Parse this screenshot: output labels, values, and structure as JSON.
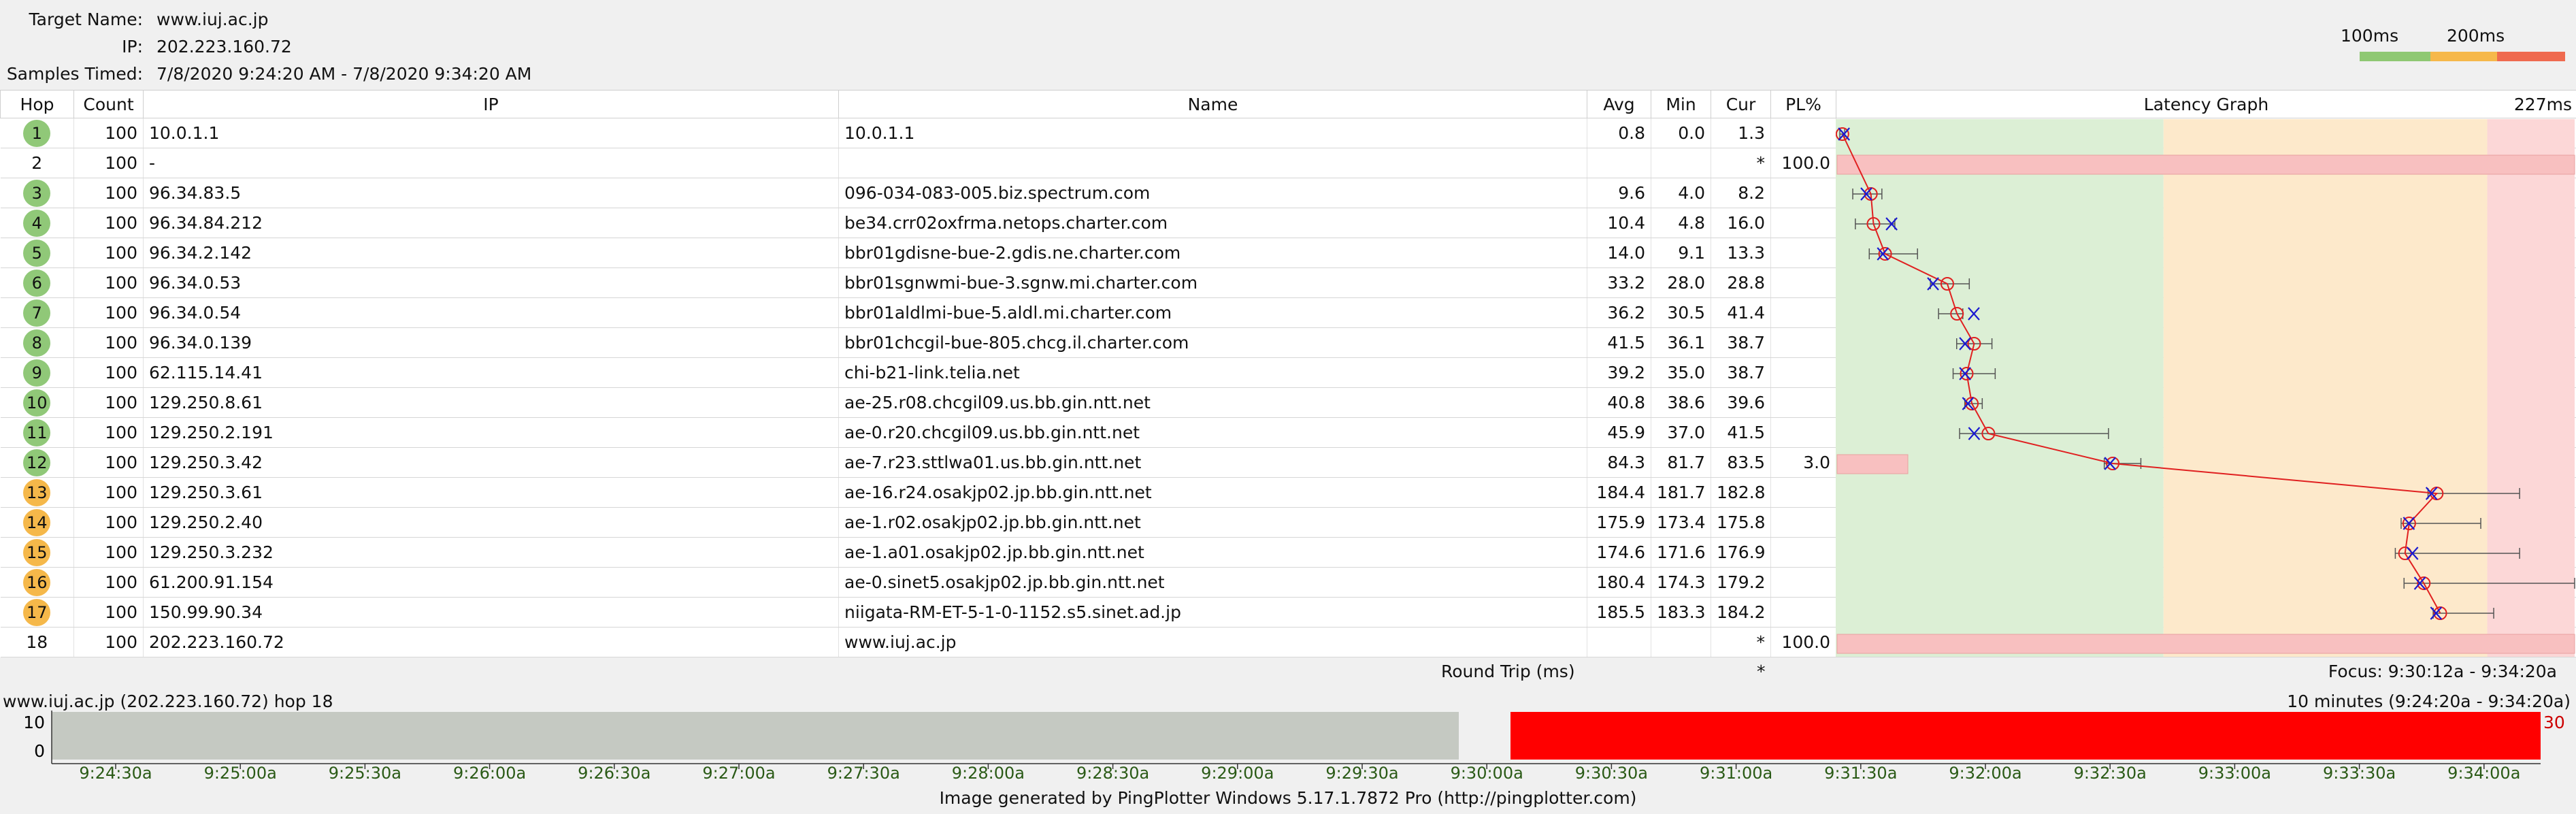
{
  "header": {
    "target_label": "Target Name:",
    "target_value": "www.iuj.ac.jp",
    "ip_label": "IP:",
    "ip_value": "202.223.160.72",
    "samples_label": "Samples Timed:",
    "samples_value": "7/8/2020 9:24:20 AM - 7/8/2020 9:34:20 AM"
  },
  "scale": {
    "label1": "100ms",
    "label2": "200ms",
    "colors": [
      "#8fc873",
      "#f6b84b",
      "#ef6a4f"
    ]
  },
  "columns": {
    "hop": "Hop",
    "count": "Count",
    "ip": "IP",
    "name": "Name",
    "avg": "Avg",
    "min": "Min",
    "cur": "Cur",
    "pl": "PL%",
    "graph": "Latency Graph",
    "graph_max": "227ms"
  },
  "hops": [
    {
      "hop": "1",
      "count": "100",
      "ip": "10.0.1.1",
      "name": "10.0.1.1",
      "avg": "0.8",
      "min": "0.0",
      "cur": "1.3",
      "pl": "",
      "color": "green"
    },
    {
      "hop": "2",
      "count": "100",
      "ip": "-",
      "name": "",
      "avg": "",
      "min": "",
      "cur": "*",
      "pl": "100.0",
      "color": "none"
    },
    {
      "hop": "3",
      "count": "100",
      "ip": "96.34.83.5",
      "name": "096-034-083-005.biz.spectrum.com",
      "avg": "9.6",
      "min": "4.0",
      "cur": "8.2",
      "pl": "",
      "color": "green"
    },
    {
      "hop": "4",
      "count": "100",
      "ip": "96.34.84.212",
      "name": "be34.crr02oxfrma.netops.charter.com",
      "avg": "10.4",
      "min": "4.8",
      "cur": "16.0",
      "pl": "",
      "color": "green"
    },
    {
      "hop": "5",
      "count": "100",
      "ip": "96.34.2.142",
      "name": "bbr01gdisne-bue-2.gdis.ne.charter.com",
      "avg": "14.0",
      "min": "9.1",
      "cur": "13.3",
      "pl": "",
      "color": "green"
    },
    {
      "hop": "6",
      "count": "100",
      "ip": "96.34.0.53",
      "name": "bbr01sgnwmi-bue-3.sgnw.mi.charter.com",
      "avg": "33.2",
      "min": "28.0",
      "cur": "28.8",
      "pl": "",
      "color": "green"
    },
    {
      "hop": "7",
      "count": "100",
      "ip": "96.34.0.54",
      "name": "bbr01aldlmi-bue-5.aldl.mi.charter.com",
      "avg": "36.2",
      "min": "30.5",
      "cur": "41.4",
      "pl": "",
      "color": "green"
    },
    {
      "hop": "8",
      "count": "100",
      "ip": "96.34.0.139",
      "name": "bbr01chcgil-bue-805.chcg.il.charter.com",
      "avg": "41.5",
      "min": "36.1",
      "cur": "38.7",
      "pl": "",
      "color": "green"
    },
    {
      "hop": "9",
      "count": "100",
      "ip": "62.115.14.41",
      "name": "chi-b21-link.telia.net",
      "avg": "39.2",
      "min": "35.0",
      "cur": "38.7",
      "pl": "",
      "color": "green"
    },
    {
      "hop": "10",
      "count": "100",
      "ip": "129.250.8.61",
      "name": "ae-25.r08.chcgil09.us.bb.gin.ntt.net",
      "avg": "40.8",
      "min": "38.6",
      "cur": "39.6",
      "pl": "",
      "color": "green"
    },
    {
      "hop": "11",
      "count": "100",
      "ip": "129.250.2.191",
      "name": "ae-0.r20.chcgil09.us.bb.gin.ntt.net",
      "avg": "45.9",
      "min": "37.0",
      "cur": "41.5",
      "pl": "",
      "color": "green"
    },
    {
      "hop": "12",
      "count": "100",
      "ip": "129.250.3.42",
      "name": "ae-7.r23.sttlwa01.us.bb.gin.ntt.net",
      "avg": "84.3",
      "min": "81.7",
      "cur": "83.5",
      "pl": "3.0",
      "color": "green"
    },
    {
      "hop": "13",
      "count": "100",
      "ip": "129.250.3.61",
      "name": "ae-16.r24.osakjp02.jp.bb.gin.ntt.net",
      "avg": "184.4",
      "min": "181.7",
      "cur": "182.8",
      "pl": "",
      "color": "orange"
    },
    {
      "hop": "14",
      "count": "100",
      "ip": "129.250.2.40",
      "name": "ae-1.r02.osakjp02.jp.bb.gin.ntt.net",
      "avg": "175.9",
      "min": "173.4",
      "cur": "175.8",
      "pl": "",
      "color": "orange"
    },
    {
      "hop": "15",
      "count": "100",
      "ip": "129.250.3.232",
      "name": "ae-1.a01.osakjp02.jp.bb.gin.ntt.net",
      "avg": "174.6",
      "min": "171.6",
      "cur": "176.9",
      "pl": "",
      "color": "orange"
    },
    {
      "hop": "16",
      "count": "100",
      "ip": "61.200.91.154",
      "name": "ae-0.sinet5.osakjp02.jp.bb.gin.ntt.net",
      "avg": "180.4",
      "min": "174.3",
      "cur": "179.2",
      "pl": "",
      "color": "orange"
    },
    {
      "hop": "17",
      "count": "100",
      "ip": "150.99.90.34",
      "name": "niigata-RM-ET-5-1-0-1152.s5.sinet.ad.jp",
      "avg": "185.5",
      "min": "183.3",
      "cur": "184.2",
      "pl": "",
      "color": "orange"
    },
    {
      "hop": "18",
      "count": "100",
      "ip": "202.223.160.72",
      "name": "www.iuj.ac.jp",
      "avg": "",
      "min": "",
      "cur": "*",
      "pl": "100.0",
      "color": "none"
    }
  ],
  "chart_data": {
    "type": "line",
    "title": "Latency Graph",
    "x_max_label": "227ms",
    "xlim": [
      0,
      227
    ],
    "zones": [
      {
        "from": 0,
        "to": 100,
        "color": "#dcefd5"
      },
      {
        "from": 100,
        "to": 200,
        "color": "#fde9cb"
      },
      {
        "from": 200,
        "to": 227,
        "color": "#fcd7d7"
      }
    ],
    "series": [
      {
        "values": [
          0.8,
          null,
          9.6,
          10.4,
          14.0,
          33.2,
          36.2,
          41.5,
          39.2,
          40.8,
          45.9,
          84.3,
          184.4,
          175.9,
          174.6,
          180.4,
          185.5,
          null
        ]
      }
    ],
    "cur": [
      1.3,
      null,
      8.2,
      16.0,
      13.3,
      28.8,
      41.4,
      38.7,
      38.7,
      39.6,
      41.5,
      83.5,
      182.8,
      175.8,
      176.9,
      179.2,
      184.2,
      null
    ],
    "min": [
      0.0,
      null,
      4.0,
      4.8,
      9.1,
      28.0,
      30.5,
      36.1,
      35.0,
      38.6,
      37.0,
      81.7,
      181.7,
      173.4,
      171.6,
      174.3,
      183.3,
      null
    ],
    "max": [
      1.5,
      null,
      13.0,
      17.0,
      24.0,
      40.0,
      38.0,
      47.0,
      48.0,
      44.0,
      83.0,
      93.0,
      210.0,
      198.0,
      210.0,
      227.0,
      202.0,
      null
    ],
    "pl": [
      0,
      100,
      0,
      0,
      0,
      0,
      0,
      0,
      0,
      0,
      0,
      3,
      0,
      0,
      0,
      0,
      0,
      100
    ]
  },
  "roundtrip": {
    "label": "Round Trip (ms)",
    "cur": "*",
    "focus": "Focus: 9:30:12a - 9:34:20a"
  },
  "timeline": {
    "title": "www.iuj.ac.jp (202.223.160.72) hop 18",
    "range": "10 minutes (9:24:20a - 9:34:20a)",
    "y_top": "10",
    "y_bottom": "0",
    "right_value": "30",
    "ticks": [
      "9:24:30a",
      "9:25:00a",
      "9:25:30a",
      "9:26:00a",
      "9:26:30a",
      "9:27:00a",
      "9:27:30a",
      "9:28:00a",
      "9:28:30a",
      "9:29:00a",
      "9:29:30a",
      "9:30:00a",
      "9:30:30a",
      "9:31:00a",
      "9:31:30a",
      "9:32:00a",
      "9:32:30a",
      "9:33:00a",
      "9:33:30a",
      "9:34:00a"
    ],
    "grey_color": "#c5c9c2",
    "red_color": "#ff0000",
    "tick_color": "#2a5a16"
  },
  "footer": "Image generated by PingPlotter Windows 5.17.1.7872 Pro (http://pingplotter.com)"
}
